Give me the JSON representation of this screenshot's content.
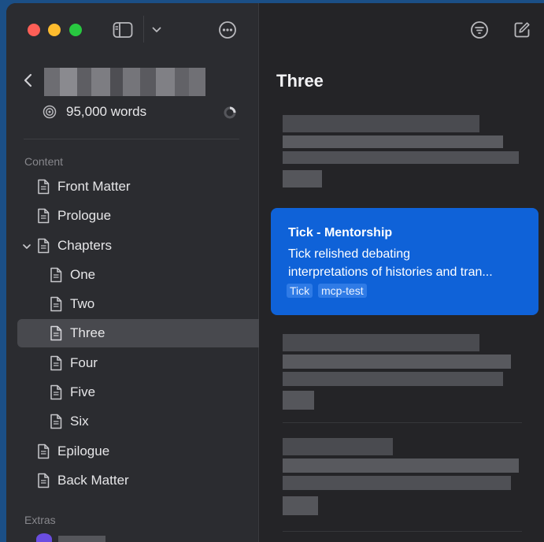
{
  "window": {
    "colors": {
      "accent": "#0f62d8",
      "selection": "#48494e",
      "sidebar": "#2b2c30"
    }
  },
  "sidebar": {
    "word_count": "95,000 words",
    "content_label": "Content",
    "extras_label": "Extras",
    "items": [
      {
        "label": "Front Matter"
      },
      {
        "label": "Prologue"
      },
      {
        "label": "Chapters"
      },
      {
        "label": "One"
      },
      {
        "label": "Two"
      },
      {
        "label": "Three"
      },
      {
        "label": "Four"
      },
      {
        "label": "Five"
      },
      {
        "label": "Six"
      },
      {
        "label": "Epilogue"
      },
      {
        "label": "Back Matter"
      }
    ]
  },
  "detail": {
    "title": "Three",
    "selected_card": {
      "title": "Tick - Mentorship",
      "line1": "Tick relished debating",
      "line2": "interpretations of histories and tran...",
      "tags": [
        "Tick",
        "mcp-test"
      ]
    }
  }
}
